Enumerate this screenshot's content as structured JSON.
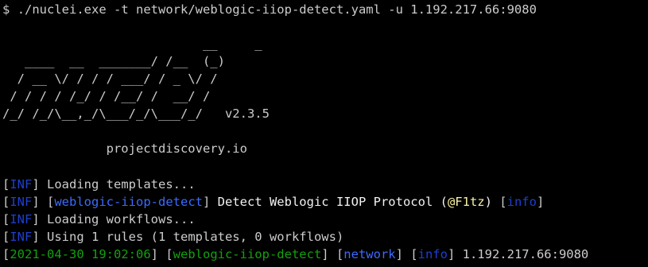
{
  "command": {
    "prompt": "$",
    "text": "./nuclei.exe -t network/weblogic-iiop-detect.yaml -u 1.192.217.66:9080"
  },
  "banner": {
    "ascii_art": "                           __     _\n   ____  __  _______/ /__  (_)\n  / __ \\/ / / / ___/ / _ \\/ /\n / / / / /_/ / /__/ /  __/ /\n/_/ /_/\\__,_/\\___/_/\\___/_/   v2.3.5\n\n              projectdiscovery.io"
  },
  "log_lines": [
    {
      "tag": "INF",
      "text": "Loading templates..."
    },
    {
      "tag": "INF",
      "template": "weblogic-iiop-detect",
      "text_before": "Detect Weblogic IIOP Protocol (",
      "author": "@F1tz",
      "text_after": ")",
      "severity": "info"
    },
    {
      "tag": "INF",
      "text": "Loading workflows..."
    },
    {
      "tag": "INF",
      "text": "Using 1 rules (1 templates, 0 workflows)"
    }
  ],
  "result": {
    "timestamp": "2021-04-30 19:02:06",
    "template": "weblogic-iiop-detect",
    "protocol": "network",
    "severity": "info",
    "target": "1.192.217.66:9080"
  },
  "colors": {
    "background": "#000000",
    "text": "#cccccc",
    "tag": "#1e3fd1",
    "template": "#3b6bff",
    "timestamp": "#13a10e",
    "author": "#f9f1a5"
  }
}
